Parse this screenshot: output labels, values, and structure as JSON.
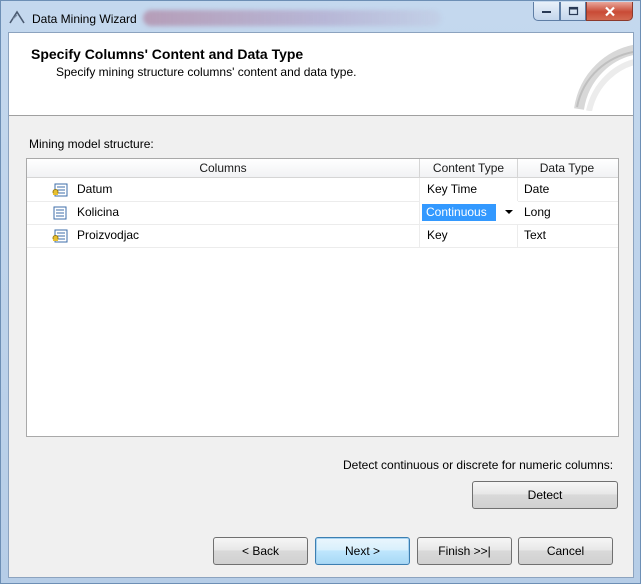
{
  "window": {
    "title": "Data Mining Wizard"
  },
  "header": {
    "title": "Specify Columns' Content and Data Type",
    "subtitle": "Specify mining structure columns' content and data type."
  },
  "structure": {
    "label": "Mining model structure:",
    "columns": {
      "name": "Columns",
      "content_type": "Content Type",
      "data_type": "Data Type"
    },
    "rows": [
      {
        "name": "Datum",
        "icon": "key-column-icon",
        "content_type": "Key Time",
        "data_type": "Date"
      },
      {
        "name": "Kolicina",
        "icon": "column-icon",
        "content_type": "Continuous",
        "data_type": "Long"
      },
      {
        "name": "Proizvodjac",
        "icon": "key-column-icon",
        "content_type": "Key",
        "data_type": "Text"
      }
    ]
  },
  "detect": {
    "label": "Detect continuous or discrete for numeric columns:",
    "button": "Detect"
  },
  "buttons": {
    "back": "< Back",
    "next": "Next >",
    "finish": "Finish >>|",
    "cancel": "Cancel"
  },
  "colors": {
    "selection": "#3399ff",
    "title_bar": "#c4d8ee",
    "close_button": "#c94b36"
  }
}
